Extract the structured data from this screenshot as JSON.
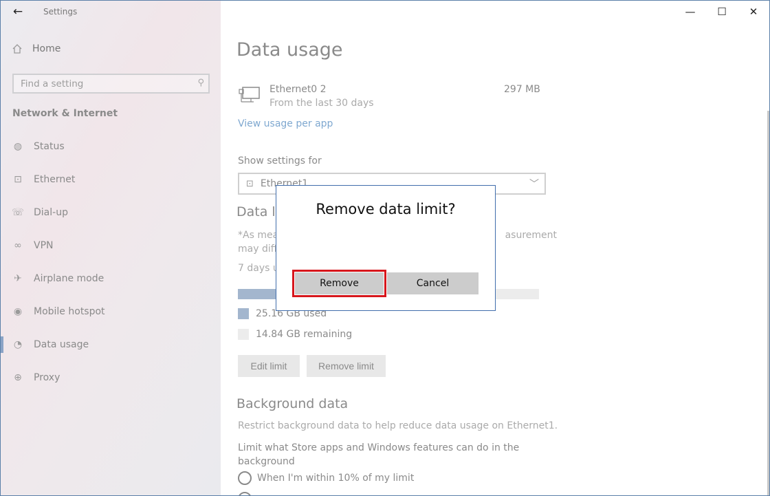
{
  "window": {
    "app_title": "Settings",
    "controls": {
      "minimize": "—",
      "maximize": "☐",
      "close": "✕"
    }
  },
  "sidebar": {
    "home_label": "Home",
    "search_placeholder": "Find a setting",
    "section_title": "Network & Internet",
    "items": [
      {
        "label": "Status",
        "icon": "globe-icon",
        "glyph": "◍"
      },
      {
        "label": "Ethernet",
        "icon": "ethernet-icon",
        "glyph": "⊡"
      },
      {
        "label": "Dial-up",
        "icon": "dialup-icon",
        "glyph": "☏"
      },
      {
        "label": "VPN",
        "icon": "vpn-icon",
        "glyph": "∞"
      },
      {
        "label": "Airplane mode",
        "icon": "airplane-icon",
        "glyph": "✈"
      },
      {
        "label": "Mobile hotspot",
        "icon": "hotspot-icon",
        "glyph": "◉"
      },
      {
        "label": "Data usage",
        "icon": "data-usage-icon",
        "glyph": "◔",
        "active": true
      },
      {
        "label": "Proxy",
        "icon": "proxy-icon",
        "glyph": "⊕"
      }
    ]
  },
  "main": {
    "page_title": "Data usage",
    "ethernet": {
      "name": "Ethernet0 2",
      "subtitle": "From the last 30 days",
      "size": "297 MB"
    },
    "view_usage_link": "View usage per app",
    "show_settings_label": "Show settings for",
    "show_settings_value": "Ethernet1",
    "data_limit_title": "Data li",
    "data_limit_note_1": "*As mea",
    "data_limit_note_1_end": "asurement",
    "data_limit_note_2": "may diff",
    "data_limit_days": "7 days u",
    "usage": {
      "used_fraction": 0.628,
      "used_color": "#a3b6ce",
      "remaining_color": "#ececec"
    },
    "used_label": "25.16 GB used",
    "remaining_label": "14.84 GB remaining",
    "edit_limit": "Edit limit",
    "remove_limit": "Remove limit",
    "background_title": "Background data",
    "background_desc": "Restrict background data to help reduce data usage on Ethernet1.",
    "background_limit": "Limit what Store apps and Windows features can do in the background",
    "radio_1": "When I'm within 10% of my limit"
  },
  "dialog": {
    "title": "Remove data limit?",
    "remove_button": "Remove",
    "cancel_button": "Cancel",
    "highlight_color": "#d7161c"
  }
}
